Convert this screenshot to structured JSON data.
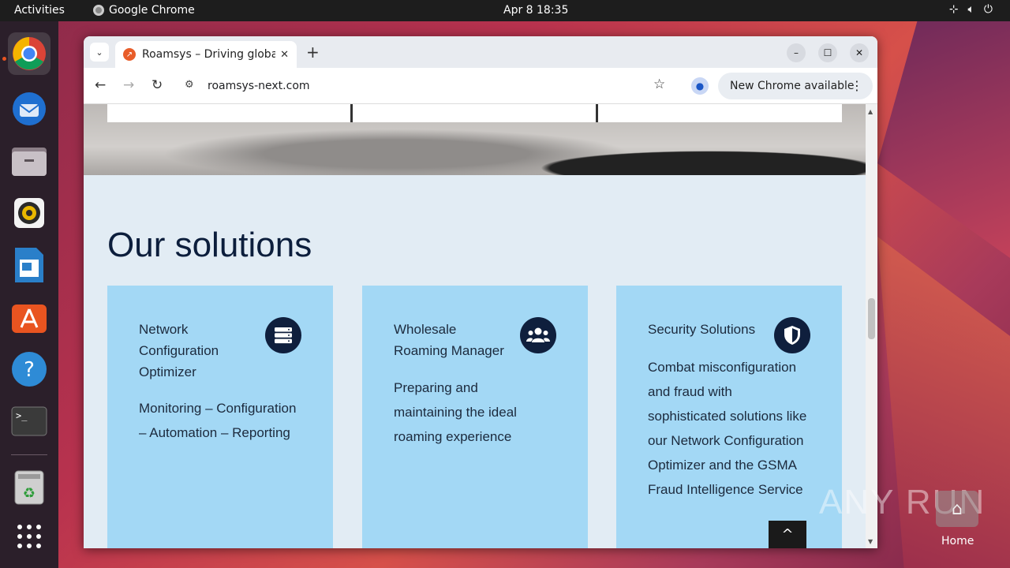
{
  "topbar": {
    "activities": "Activities",
    "app_name": "Google Chrome",
    "clock": "Apr 8  18:35"
  },
  "dock": {
    "items": [
      "chrome-icon",
      "thunderbird-icon",
      "files-icon",
      "rhythmbox-icon",
      "writer-icon",
      "app-center-icon",
      "help-icon",
      "terminal-icon",
      "trash-icon",
      "app-grid-icon"
    ]
  },
  "browser": {
    "tab_title": "Roamsys – Driving globa",
    "new_tab": "+",
    "url": "roamsys-next.com",
    "update_label": "New Chrome available"
  },
  "page": {
    "heading": "Our solutions",
    "cards": [
      {
        "title": "Network Configuration Optimizer",
        "description": "Monitoring – Configuration – Automation – Reporting",
        "icon": "server-icon"
      },
      {
        "title": "Wholesale Roaming Manager",
        "description": "Preparing and maintaining the ideal roaming experience",
        "icon": "users-icon"
      },
      {
        "title": "Security Solutions",
        "description": "Combat misconfiguration and fraud with sophisticated solutions like our Network Configuration Optimizer and the GSMA Fraud Intelligence Service",
        "icon": "shield-icon"
      }
    ],
    "back_to_top": "^"
  },
  "desktop": {
    "watermark": "ANY RUN",
    "home_label": "Home"
  },
  "colors": {
    "card_bg": "#a3d8f5",
    "section_bg": "#e2ecf4",
    "heading": "#0c1e3c",
    "badge": "#0f1f3d"
  }
}
